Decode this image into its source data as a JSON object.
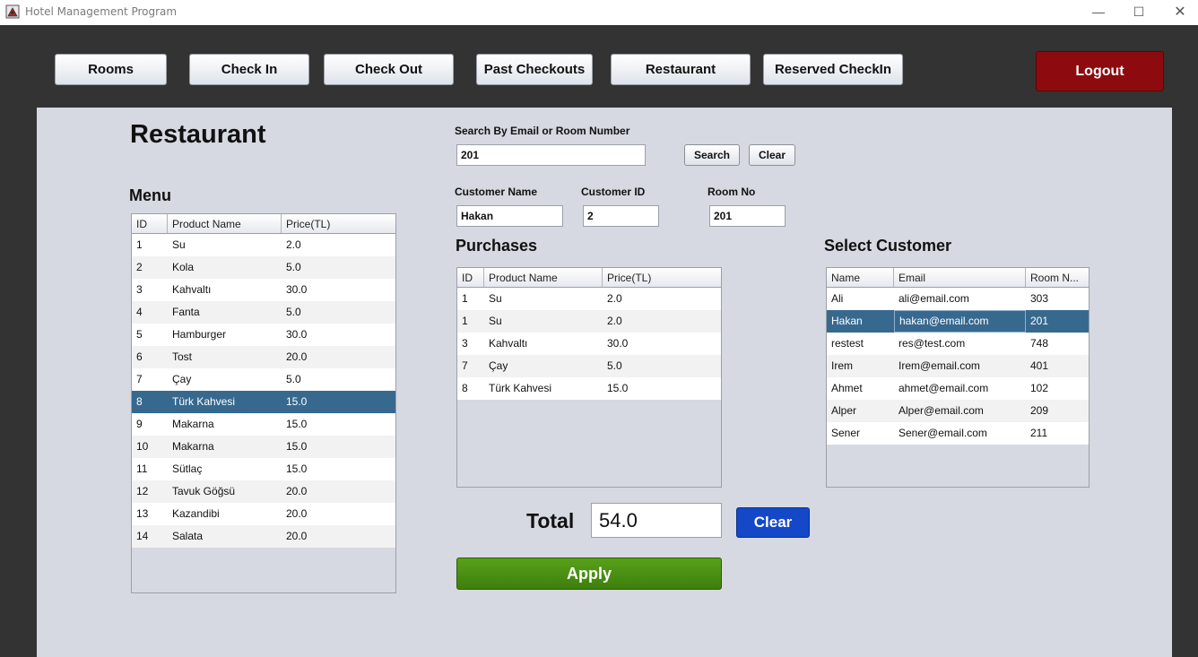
{
  "window": {
    "title": "Hotel Management Program"
  },
  "nav": {
    "rooms": "Rooms",
    "check_in": "Check In",
    "check_out": "Check Out",
    "past_checkouts": "Past Checkouts",
    "restaurant": "Restaurant",
    "reserved_checkin": "Reserved CheckIn",
    "logout": "Logout"
  },
  "page": {
    "title": "Restaurant"
  },
  "search": {
    "label": "Search By Email or Room Number",
    "value": "201",
    "search_button": "Search",
    "clear_button": "Clear"
  },
  "customer": {
    "name_label": "Customer Name",
    "name_value": "Hakan",
    "id_label": "Customer ID",
    "id_value": "2",
    "room_label": "Room No",
    "room_value": "201"
  },
  "menu": {
    "title": "Menu",
    "columns": [
      "ID",
      "Product Name",
      "Price(TL)"
    ],
    "rows": [
      [
        "1",
        "Su",
        "2.0"
      ],
      [
        "2",
        "Kola",
        "5.0"
      ],
      [
        "3",
        "Kahvaltı",
        "30.0"
      ],
      [
        "4",
        "Fanta",
        "5.0"
      ],
      [
        "5",
        "Hamburger",
        "30.0"
      ],
      [
        "6",
        "Tost",
        "20.0"
      ],
      [
        "7",
        "Çay",
        "5.0"
      ],
      [
        "8",
        "Türk Kahvesi",
        "15.0"
      ],
      [
        "9",
        "Makarna",
        "15.0"
      ],
      [
        "10",
        "Makarna",
        "15.0"
      ],
      [
        "11",
        "Sütlaç",
        "15.0"
      ],
      [
        "12",
        "Tavuk Göğsü",
        "20.0"
      ],
      [
        "13",
        "Kazandibi",
        "20.0"
      ],
      [
        "14",
        "Salata",
        "20.0"
      ]
    ],
    "selected_index": 7
  },
  "purchases": {
    "title": "Purchases",
    "columns": [
      "ID",
      "Product Name",
      "Price(TL)"
    ],
    "rows": [
      [
        "1",
        "Su",
        "2.0"
      ],
      [
        "1",
        "Su",
        "2.0"
      ],
      [
        "3",
        "Kahvaltı",
        "30.0"
      ],
      [
        "7",
        "Çay",
        "5.0"
      ],
      [
        "8",
        "Türk Kahvesi",
        "15.0"
      ]
    ]
  },
  "select_customer": {
    "title": "Select Customer",
    "columns": [
      "Name",
      "Email",
      "Room N..."
    ],
    "rows": [
      [
        "Ali",
        "ali@email.com",
        "303"
      ],
      [
        "Hakan",
        "hakan@email.com",
        "201"
      ],
      [
        "restest",
        "res@test.com",
        "748"
      ],
      [
        "Irem",
        "Irem@email.com",
        "401"
      ],
      [
        "Ahmet",
        "ahmet@email.com",
        "102"
      ],
      [
        "Alper",
        "Alper@email.com",
        "209"
      ],
      [
        "Sener",
        "Sener@email.com",
        "211"
      ]
    ],
    "selected_index": 1
  },
  "total": {
    "label": "Total",
    "value": "54.0",
    "clear_button": "Clear",
    "apply_button": "Apply"
  },
  "colors": {
    "selection": "#37698f",
    "logout": "#8d0b0e",
    "clear_blue": "#1448c8",
    "apply_green": "#4a8f12"
  }
}
